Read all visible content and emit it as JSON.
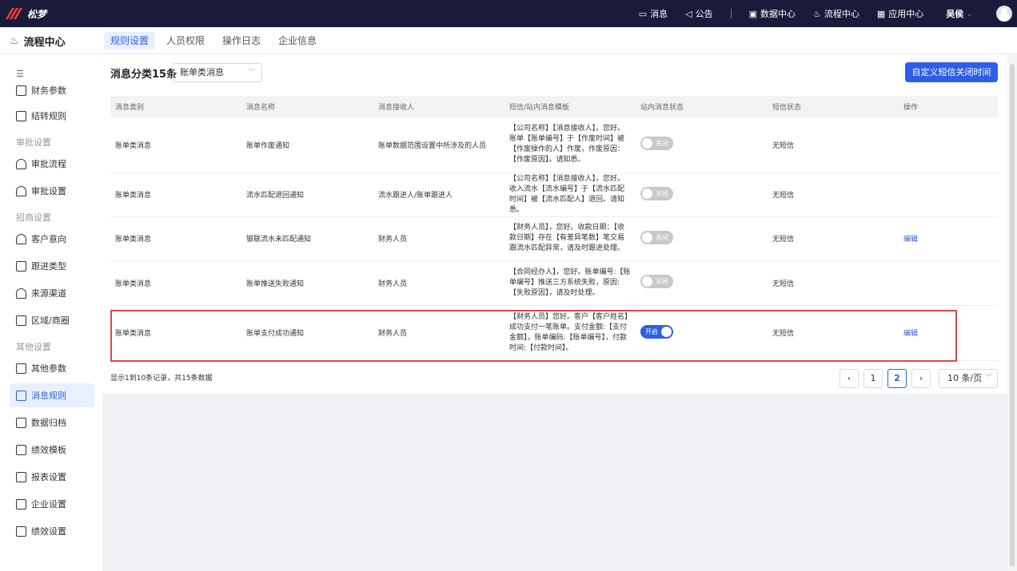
{
  "topbar": {
    "brand": "松梦",
    "nav": [
      {
        "label": "消息",
        "icon": "message-icon"
      },
      {
        "label": "公告",
        "icon": "announce-icon"
      },
      {
        "label": "数据中心",
        "icon": "data-center-icon"
      },
      {
        "label": "流程中心",
        "icon": "process-center-icon"
      },
      {
        "label": "应用中心",
        "icon": "app-center-icon"
      }
    ],
    "user": "吴侯"
  },
  "header": {
    "title": "流程中心",
    "tabs": [
      "规则设置",
      "人员权限",
      "操作日志",
      "企业信息"
    ],
    "active_tab": 0
  },
  "sidebar": {
    "items": [
      {
        "label": "财务参数",
        "icon": "finance-icon"
      },
      {
        "label": "结转规则",
        "icon": "carryover-icon"
      },
      {
        "group": "审批设置"
      },
      {
        "label": "审批流程",
        "icon": "approval-flow-icon"
      },
      {
        "label": "审批设置",
        "icon": "approval-settings-icon"
      },
      {
        "group": "招商设置"
      },
      {
        "label": "客户意向",
        "icon": "customer-intent-icon"
      },
      {
        "label": "跟进类型",
        "icon": "followup-type-icon"
      },
      {
        "label": "来源渠道",
        "icon": "source-channel-icon"
      },
      {
        "label": "区域/商圈",
        "icon": "region-icon"
      },
      {
        "group": "其他设置"
      },
      {
        "label": "其他参数",
        "icon": "other-params-icon"
      },
      {
        "label": "消息规则",
        "icon": "message-rules-icon",
        "active": true
      },
      {
        "label": "数据归档",
        "icon": "archive-icon"
      },
      {
        "label": "绩效模板",
        "icon": "performance-template-icon"
      },
      {
        "label": "报表设置",
        "icon": "report-settings-icon"
      },
      {
        "label": "企业设置",
        "icon": "enterprise-settings-icon"
      },
      {
        "label": "绩效设置",
        "icon": "performance-settings-icon"
      }
    ]
  },
  "main": {
    "filter_label": "消息分类15条",
    "filter_value": "账单类消息",
    "custom_button": "自定义短信关闭时间",
    "columns": [
      "消息类别",
      "消息名称",
      "消息接收人",
      "短信/站内消息模板",
      "站内消息状态",
      "短信状态",
      "操作"
    ],
    "rows": [
      {
        "category": "账单类消息",
        "name": "账单作废通知",
        "receiver": "账单数据范围设置中所涉及的人员",
        "template": "【公司名称】【消息接收人】，您好。账单【账单编号】于【作废时间】被【作废操作的人】作废，作废原因：【作废原因】。请知悉。",
        "status": "关闭",
        "on": false,
        "sms": "无短信",
        "action": ""
      },
      {
        "category": "账单类消息",
        "name": "流水匹配退回通知",
        "receiver": "流水跟进人/账单跟进人",
        "template": "【公司名称】【消息接收人】，您好。收入流水【流水编号】于【流水匹配时间】被【流水匹配人】退回。请知悉。",
        "status": "关闭",
        "on": false,
        "sms": "无短信",
        "action": ""
      },
      {
        "category": "账单类消息",
        "name": "银联流水未匹配通知",
        "receiver": "财务人员",
        "template": "【财务人员】，您好。收款日期：【收款日期】存在【有差异笔数】笔交易跟流水匹配异常，请及时跟进处理。",
        "status": "关闭",
        "on": false,
        "sms": "无短信",
        "action": "编辑"
      },
      {
        "category": "账单类消息",
        "name": "账单推送失败通知",
        "receiver": "财务人员",
        "template": "【合同经办人】，您好。账单编号:【账单编号】推送三方系统失败，原因:【失败原因】，请及时处理。",
        "status": "关闭",
        "on": false,
        "sms": "无短信",
        "action": ""
      },
      {
        "category": "账单类消息",
        "name": "账单支付成功通知",
        "receiver": "财务人员",
        "template": "【财务人员】您好。客户【客户姓名】成功支付一笔账单。支付金额:【支付金额】，账单编码:【账单编号】，付款时间:【付款时间】。",
        "status": "开启",
        "on": true,
        "sms": "无短信",
        "action": "编辑"
      }
    ],
    "footer_info": "显示1到10条记录，共15条数据",
    "pages": [
      "1",
      "2"
    ],
    "current_page": "2",
    "page_size": "10 条/页"
  }
}
